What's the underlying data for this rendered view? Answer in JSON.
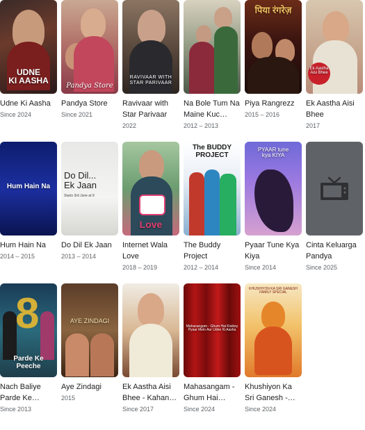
{
  "items": [
    {
      "title": "Udne Ki Aasha",
      "year": "Since 2024",
      "poster_text": "UDNE\nKI AASHA"
    },
    {
      "title": "Pandya Store",
      "year": "Since 2021",
      "poster_text": "Pandya Store"
    },
    {
      "title": "Ravivaar with Star Parivaar",
      "year": "2022",
      "poster_text": "RAVIVAAR WITH\nSTAR PARIVAAR"
    },
    {
      "title": "Na Bole Tum Na Maine Kuc…",
      "year": "2012 – 2013",
      "poster_text": ""
    },
    {
      "title": "Piya Rangrezz",
      "year": "2015 – 2016",
      "poster_text": "पिया रंगरेज़"
    },
    {
      "title": "Ek Aastha Aisi Bhee",
      "year": "2017",
      "poster_text": "Ek Aastha Aisi Bhee"
    },
    {
      "title": "Hum Hain Na",
      "year": "2014 – 2015",
      "poster_text": "Hum Hain Na"
    },
    {
      "title": "Do Dil Ek Jaan",
      "year": "2013 – 2014",
      "poster_text": "Do Dil...\nEk Jaan",
      "poster_subtext": "Starts 3rd June at 9"
    },
    {
      "title": "Internet Wala Love",
      "year": "2018 – 2019",
      "poster_text": "Love"
    },
    {
      "title": "The Buddy Project",
      "year": "2012 – 2014",
      "poster_text": "The BUDDY\nPROJECT"
    },
    {
      "title": "Pyaar Tune Kya Kiya",
      "year": "Since 2014",
      "poster_text": "PYAAR tune\nkya KIYA"
    },
    {
      "title": "Cinta Keluarga Pandya",
      "year": "Since 2025",
      "poster_text": ""
    },
    {
      "title": "Nach Baliye Parde Ke…",
      "year": "Since 2013",
      "poster_text": "Parde Ke\nPeeche"
    },
    {
      "title": "Aye Zindagi",
      "year": "2015",
      "poster_text": "AYE ZINDAGI"
    },
    {
      "title": "Ek Aastha Aisi Bhee - Kahan…",
      "year": "Since 2017",
      "poster_text": ""
    },
    {
      "title": "Mahasangam - Ghum Hai…",
      "year": "Since 2024",
      "poster_text": "Mahasangam - Ghum Hai Kisikey\nPyaar Mein Aur Udne Ki Aasha"
    },
    {
      "title": "Khushiyon Ka Sri Ganesh -…",
      "year": "Since 2024",
      "poster_text": "KHUSHIYON KA SRI GANESH\nFAMILY SPECIAL"
    }
  ],
  "colors": {
    "title_text": "#202124",
    "subtitle_text": "#5f6368",
    "placeholder_bg": "#5f6368"
  },
  "icons": {
    "placeholder": "tv-icon"
  }
}
